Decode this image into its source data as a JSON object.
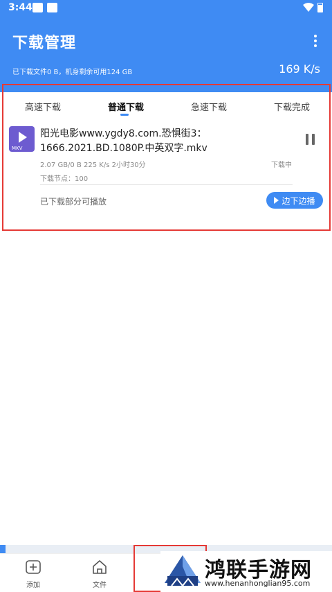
{
  "status_bar": {
    "time": "3:44"
  },
  "header": {
    "title": "下载管理",
    "summary": "已下载文件0 B，机身剩余可用124 GB",
    "speed": "169 K/s"
  },
  "tabs": [
    {
      "label": "高速下载",
      "active": false
    },
    {
      "label": "普通下载",
      "active": true
    },
    {
      "label": "急速下载",
      "active": false
    },
    {
      "label": "下载完成",
      "active": false
    }
  ],
  "download": {
    "file_type": "MKV",
    "name": "阳光电影www.ygdy8.com.恐惧街3：1666.2021.BD.1080P.中英双字.mkv",
    "meta": "2.07 GB/0 B  225 K/s  2小时30分",
    "status": "下载中",
    "nodes": "下载节点：100",
    "partial_note": "已下载部分可播放",
    "play_button": "边下边播",
    "progress": 0
  },
  "bottom_nav": {
    "items": [
      {
        "label": "添加",
        "icon": "add-file-icon"
      },
      {
        "label": "文件",
        "icon": "home-icon"
      }
    ]
  },
  "watermark": {
    "title": "鸿联手游网",
    "url": "www.henanhonglian95.com"
  },
  "colors": {
    "accent": "#3f8bf3",
    "highlight": "#e53935",
    "file_icon": "#6d5bd0"
  }
}
